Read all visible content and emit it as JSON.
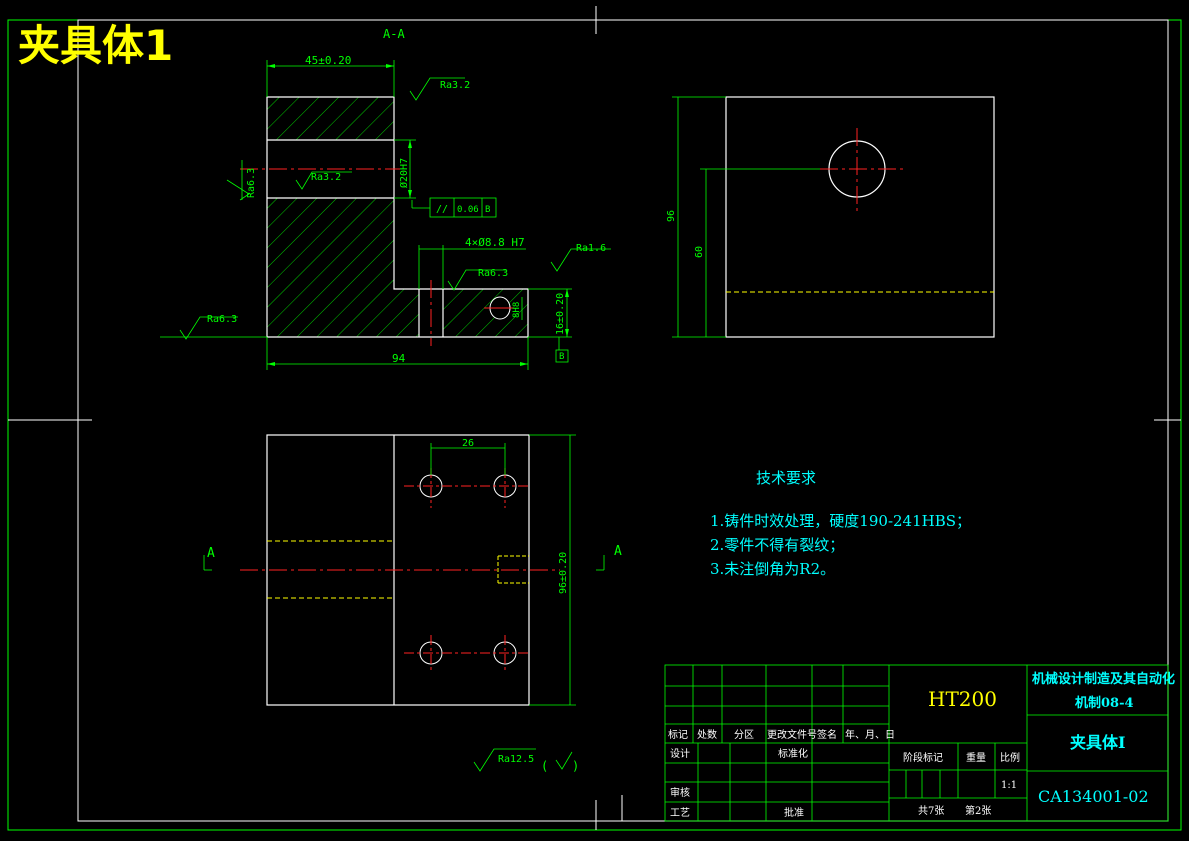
{
  "title": "夹具体1",
  "section_label": "A-A",
  "section_markers": {
    "left": "A",
    "right": "A"
  },
  "dimensions": {
    "width_45": "45±0.20",
    "bore_dia": "Ø20H7",
    "hole_spec": "4×Ø8.8 H7",
    "height_16": "16±0.20",
    "pocket_8": "8H8",
    "len_94": "94",
    "dim_26": "26",
    "dim_96": "96±0.20",
    "side_96": "96",
    "side_60": "60"
  },
  "roughness": {
    "r_top": "Ra3.2",
    "r_left_v": "Ra6.3",
    "r_bore": "Ra3.2",
    "r_hole": "Ra6.3",
    "r_right": "Ra1.6",
    "r_base": "Ra6.3",
    "r_general": "Ra12.5"
  },
  "tolerance": {
    "symbol": "//",
    "value": "0.06",
    "datum": "B"
  },
  "datum_label": "B",
  "tech_requirements": {
    "heading": "技术要求",
    "items": [
      "1.铸件时效处理，硬度190-241HBS；",
      "2.零件不得有裂纹；",
      "3.未注倒角为R2。"
    ]
  },
  "title_block": {
    "material": "HT200",
    "school": "机械设计制造及其自动化",
    "class": "机制08-4",
    "part_name": "夹具体Ⅰ",
    "drawing_no": "CA134001-02",
    "headers": [
      "标记",
      "处数",
      "分区",
      "更改文件号",
      "签名",
      "年、月、日"
    ],
    "design": "设计",
    "standard": "标准化",
    "review": "审核",
    "process": "工艺",
    "approve": "批准",
    "stage_mark": "阶段标记",
    "weight": "重量",
    "scale": "比例",
    "scale_value": "1:1",
    "sheets_total": "共7张",
    "sheet_no": "第2张"
  },
  "colors": {
    "line": "#ffffff",
    "dim": "#00ff00",
    "center": "#ff2222",
    "hidden": "#ffff00",
    "text_yellow": "#ffff00",
    "text_cyan": "#00ffff"
  }
}
